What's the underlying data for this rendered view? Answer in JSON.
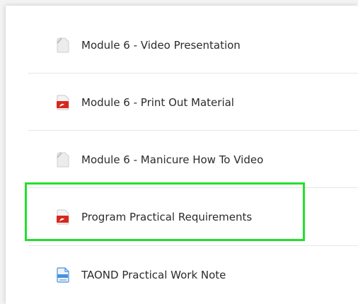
{
  "items": [
    {
      "label": "Module 6 - Video Presentation",
      "icon": "generic-file-icon"
    },
    {
      "label": "Module 6 - Print Out Material",
      "icon": "pdf-file-icon"
    },
    {
      "label": "Module 6 - Manicure How To Video",
      "icon": "generic-file-icon"
    },
    {
      "label": "Program Practical Requirements",
      "icon": "pdf-file-icon"
    },
    {
      "label": "TAOND Practical Work Note",
      "icon": "document-file-icon"
    }
  ],
  "highlight": {
    "color": "#22e02b"
  },
  "colors": {
    "pdf_red": "#d9261c",
    "doc_blue": "#4a90d9",
    "generic_gray": "#d0d0d0"
  }
}
